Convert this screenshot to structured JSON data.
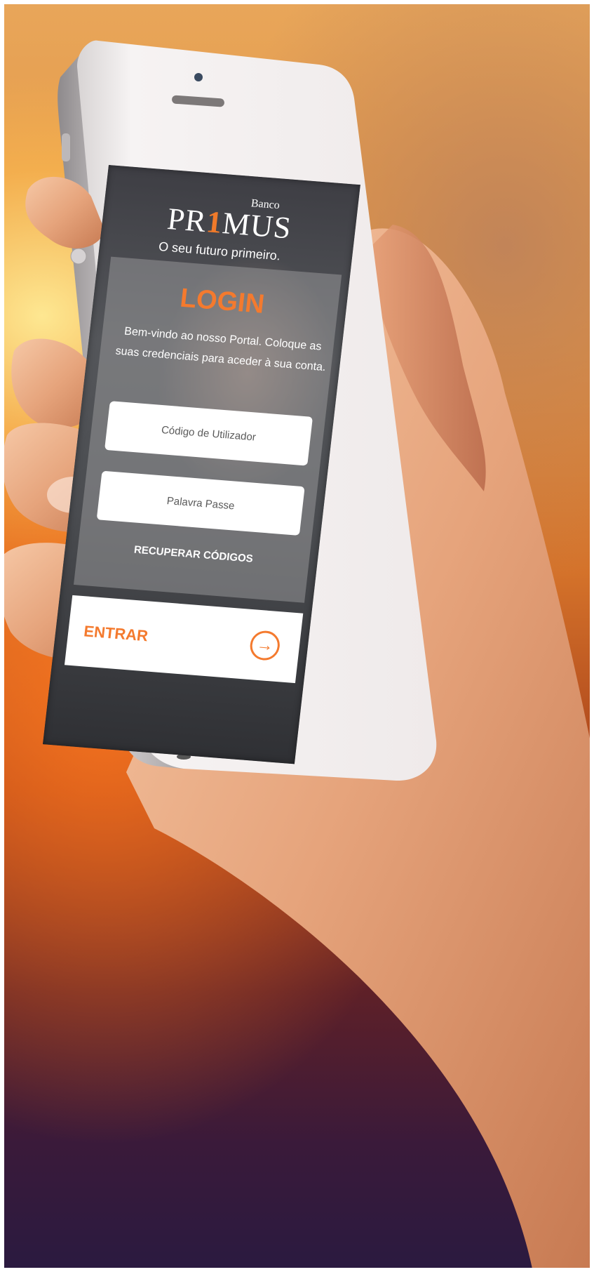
{
  "brand": {
    "banco": "Banco",
    "name_part1": "PR",
    "name_highlight": "1",
    "name_part2": "MUS",
    "tagline": "O seu futuro primeiro."
  },
  "login": {
    "title": "LOGIN",
    "welcome": "Bem-vindo ao nosso Portal. Coloque as suas credenciais para aceder à sua conta.",
    "user_field": {
      "placeholder": "Código de Utilizador",
      "value": ""
    },
    "password_field": {
      "placeholder": "Palavra Passe",
      "value": ""
    },
    "recover_label": "RECUPERAR CÓDIGOS",
    "submit_label": "ENTRAR",
    "submit_icon": "arrow-right-circle-icon"
  },
  "colors": {
    "accent": "#f47a2e",
    "panel": "#969698",
    "field_bg": "#ffffff"
  }
}
